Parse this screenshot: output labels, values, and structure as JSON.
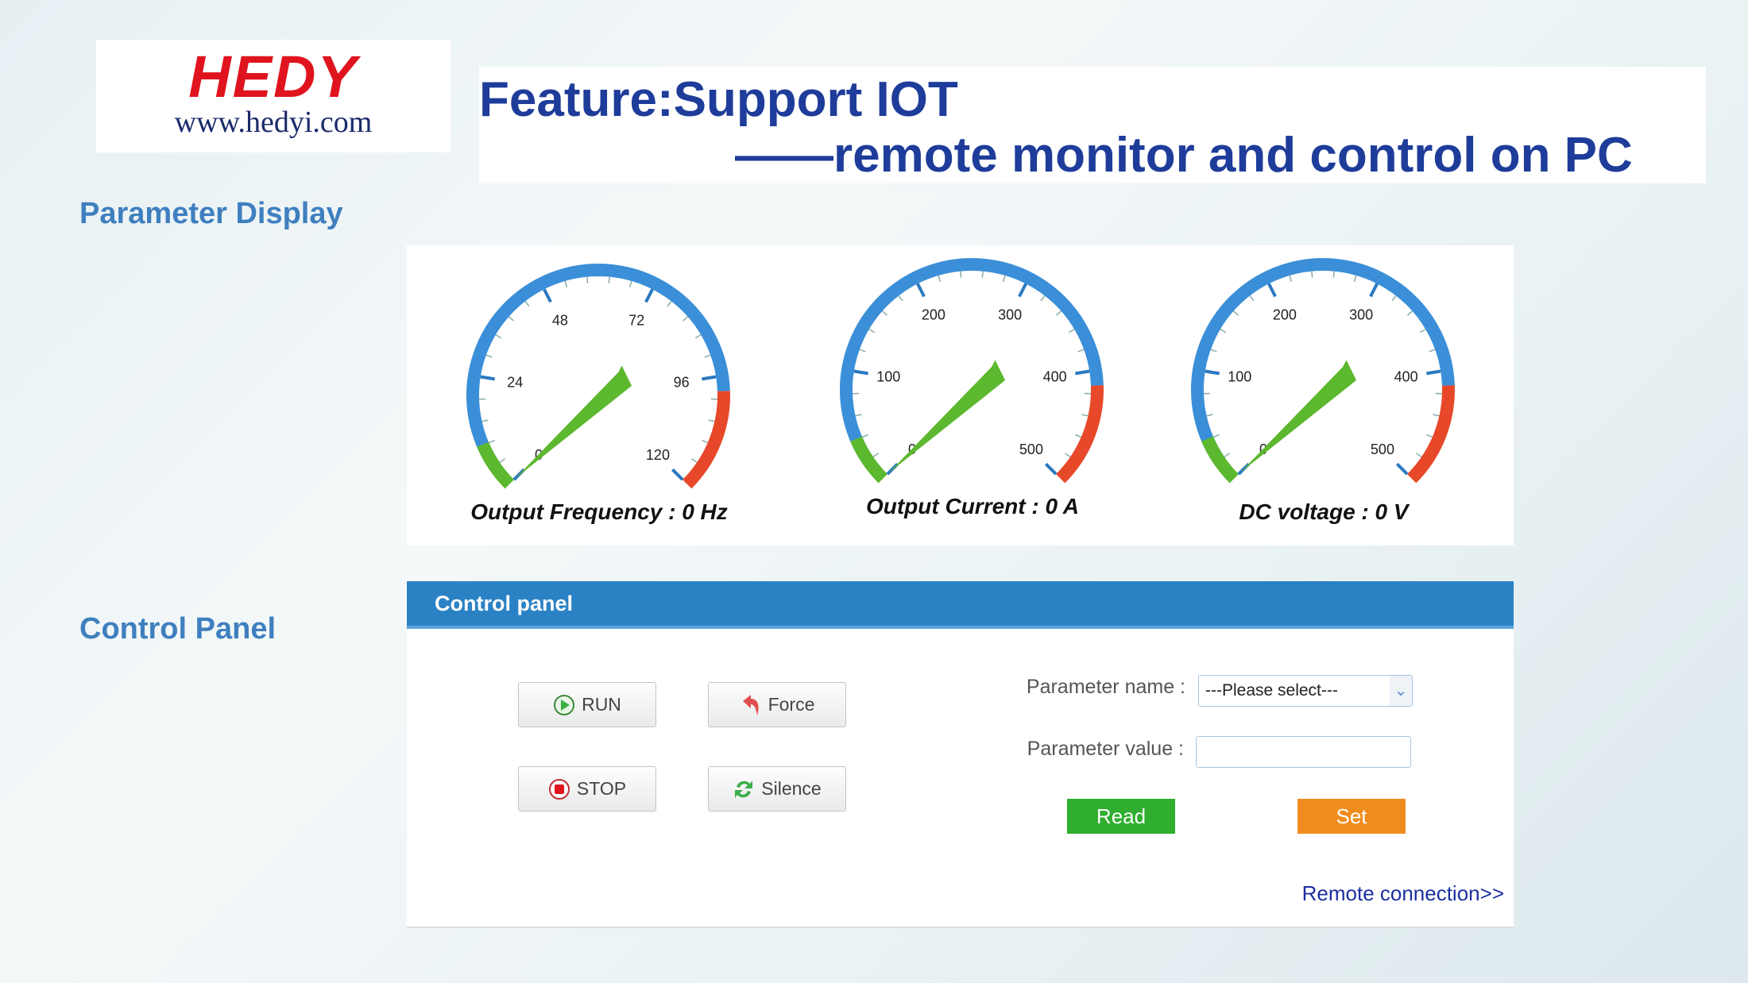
{
  "logo": {
    "brand": "HEDY",
    "url": "www.hedyi.com"
  },
  "title": {
    "line1": "Feature:Support IOT",
    "line2": "——remote monitor and control on PC"
  },
  "sections": {
    "display": "Parameter Display",
    "control": "Control Panel"
  },
  "colors": {
    "arc_blue": "#3b8fd8",
    "arc_green": "#5cb82e",
    "arc_red": "#e8482a",
    "needle": "#5cb82e",
    "header": "#2a82c4",
    "read": "#2fae2f",
    "set": "#f08c1e",
    "title": "#1e3c9a"
  },
  "gauges": [
    {
      "label": "Output Frequency : 0 Hz",
      "min": 0,
      "max": 120,
      "value": 0,
      "ticks": [
        "0",
        "24",
        "48",
        "72",
        "96",
        "120"
      ]
    },
    {
      "label": "Output Current : 0 A",
      "min": 0,
      "max": 500,
      "value": 0,
      "ticks": [
        "0",
        "100",
        "200",
        "300",
        "400",
        "500"
      ]
    },
    {
      "label": "DC voltage : 0 V",
      "min": 0,
      "max": 500,
      "value": 0,
      "ticks": [
        "0",
        "100",
        "200",
        "300",
        "400",
        "500"
      ]
    }
  ],
  "control": {
    "header": "Control panel",
    "buttons": {
      "run": "RUN",
      "force": "Force",
      "stop": "STOP",
      "silence": "Silence"
    },
    "param_name_label": "Parameter name :",
    "param_select": "---Please select---",
    "param_value_label": "Parameter value :",
    "param_value": "",
    "read": "Read",
    "set": "Set",
    "remote": "Remote connection>>"
  }
}
